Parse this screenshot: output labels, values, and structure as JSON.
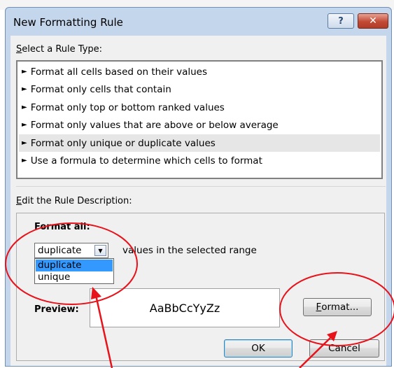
{
  "dialog": {
    "title": "New Formatting Rule",
    "help_glyph": "?",
    "close_glyph": "✕"
  },
  "rule_type": {
    "label_mnemonic": "S",
    "label_rest": "elect a Rule Type:",
    "items": [
      "Format all cells based on their values",
      "Format only cells that contain",
      "Format only top or bottom ranked values",
      "Format only values that are above or below average",
      "Format only unique or duplicate values",
      "Use a formula to determine which cells to format"
    ],
    "selected_index": 4
  },
  "description": {
    "label_mnemonic": "E",
    "label_rest": "dit the Rule Description:",
    "format_all_label": "Format all:",
    "select_value": "duplicate",
    "options": [
      "duplicate",
      "unique"
    ],
    "values_text": "values in the selected range",
    "preview_label": "Preview:",
    "preview_text": "AaBbCcYyZz",
    "format_button_mnemonic": "F",
    "format_button_rest": "ormat..."
  },
  "footer": {
    "ok_label": "OK",
    "cancel_label": "Cancel"
  },
  "colors": {
    "annotation_red": "#e8121b",
    "highlight_blue": "#3399ff",
    "titlebar_blue": "#c4d6ec"
  }
}
